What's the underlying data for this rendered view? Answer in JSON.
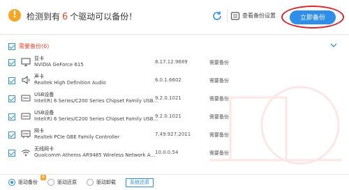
{
  "header": {
    "title_prefix": "检测到有",
    "count": "6",
    "title_suffix": "个驱动可以备份！",
    "settings_label": "查看备份设置",
    "backup_button": "立即备份"
  },
  "section": {
    "label": "需要备份(6)"
  },
  "devices": [
    {
      "category": "显卡",
      "name": "NVIDIA GeForce 615",
      "version": "8.17.12.9689",
      "status": "需要备份",
      "icon": "monitor-icon"
    },
    {
      "category": "声卡",
      "name": "Realtek High Definition Audio",
      "version": "6.0.1.6602",
      "status": "需要备份",
      "icon": "speaker-icon"
    },
    {
      "category": "USB设备",
      "name": "Intel(R) 6 Series/C200 Series Chipset Family USB...",
      "version": "9.2.0.1021",
      "status": "需要备份",
      "icon": "usb-device-icon"
    },
    {
      "category": "USB设备",
      "name": "Intel(R) 6 Series/C200 Series Chipset Family USB...",
      "version": "9.2.0.1021",
      "status": "需要备份",
      "icon": "usb-device-icon"
    },
    {
      "category": "网卡",
      "name": "Realtek PCIe GBE Family Controller",
      "version": "7.49.927.2011",
      "status": "需要备份",
      "icon": "network-card-icon"
    },
    {
      "category": "无线网卡",
      "name": "Qualcomm Atheros AR9485 Wireless Network A...",
      "version": "10.0.0.54",
      "status": "需要备份",
      "icon": "wifi-icon"
    }
  ],
  "footer": {
    "tab_backup": "驱动备份",
    "tab_backup_badge": "6",
    "tab_restore": "驱动还原",
    "tab_uninstall": "驱动卸载",
    "system_restore": "系统还原"
  },
  "colors": {
    "accent": "#2e8ee8",
    "highlight": "#e8452c",
    "annotation": "#d8262b",
    "warning": "#f5a623"
  }
}
